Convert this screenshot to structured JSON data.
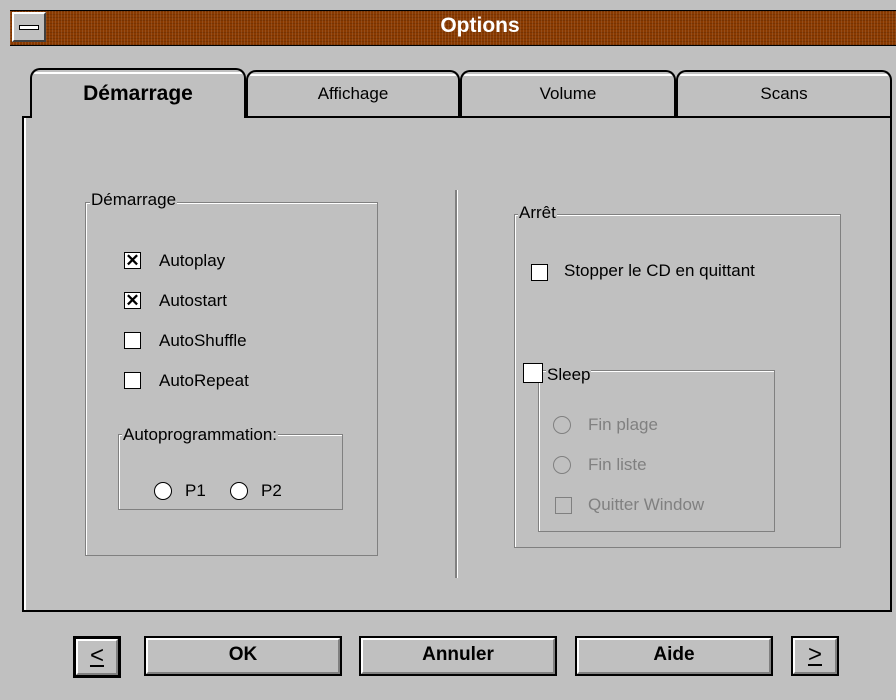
{
  "window": {
    "title": "Options"
  },
  "tabs": [
    {
      "label": "Démarrage",
      "active": true
    },
    {
      "label": "Affichage",
      "active": false
    },
    {
      "label": "Volume",
      "active": false
    },
    {
      "label": "Scans",
      "active": false
    }
  ],
  "startup_group": {
    "legend": "Démarrage",
    "options": [
      {
        "label": "Autoplay",
        "checked": true
      },
      {
        "label": "Autostart",
        "checked": true
      },
      {
        "label": "AutoShuffle",
        "checked": false
      },
      {
        "label": "AutoRepeat",
        "checked": false
      }
    ],
    "autoprog": {
      "legend": "Autoprogrammation:",
      "options": [
        {
          "label": "P1"
        },
        {
          "label": "P2"
        }
      ]
    }
  },
  "stop_group": {
    "legend": "Arrêt",
    "stop_cd": {
      "label": "Stopper le CD en quittant",
      "checked": false
    },
    "sleep": {
      "legend": "Sleep",
      "checked": false,
      "options": [
        {
          "label": "Fin plage",
          "type": "radio",
          "enabled": false
        },
        {
          "label": "Fin liste",
          "type": "radio",
          "enabled": false
        },
        {
          "label": "Quitter Window",
          "type": "checkbox",
          "enabled": false
        }
      ]
    }
  },
  "buttons": {
    "prev": "<",
    "ok": "OK",
    "cancel": "Annuler",
    "help": "Aide",
    "next": ">"
  },
  "colors": {
    "titlebar": "#8a3a00",
    "face": "#c0c0c0",
    "disabled_text": "#808080"
  }
}
